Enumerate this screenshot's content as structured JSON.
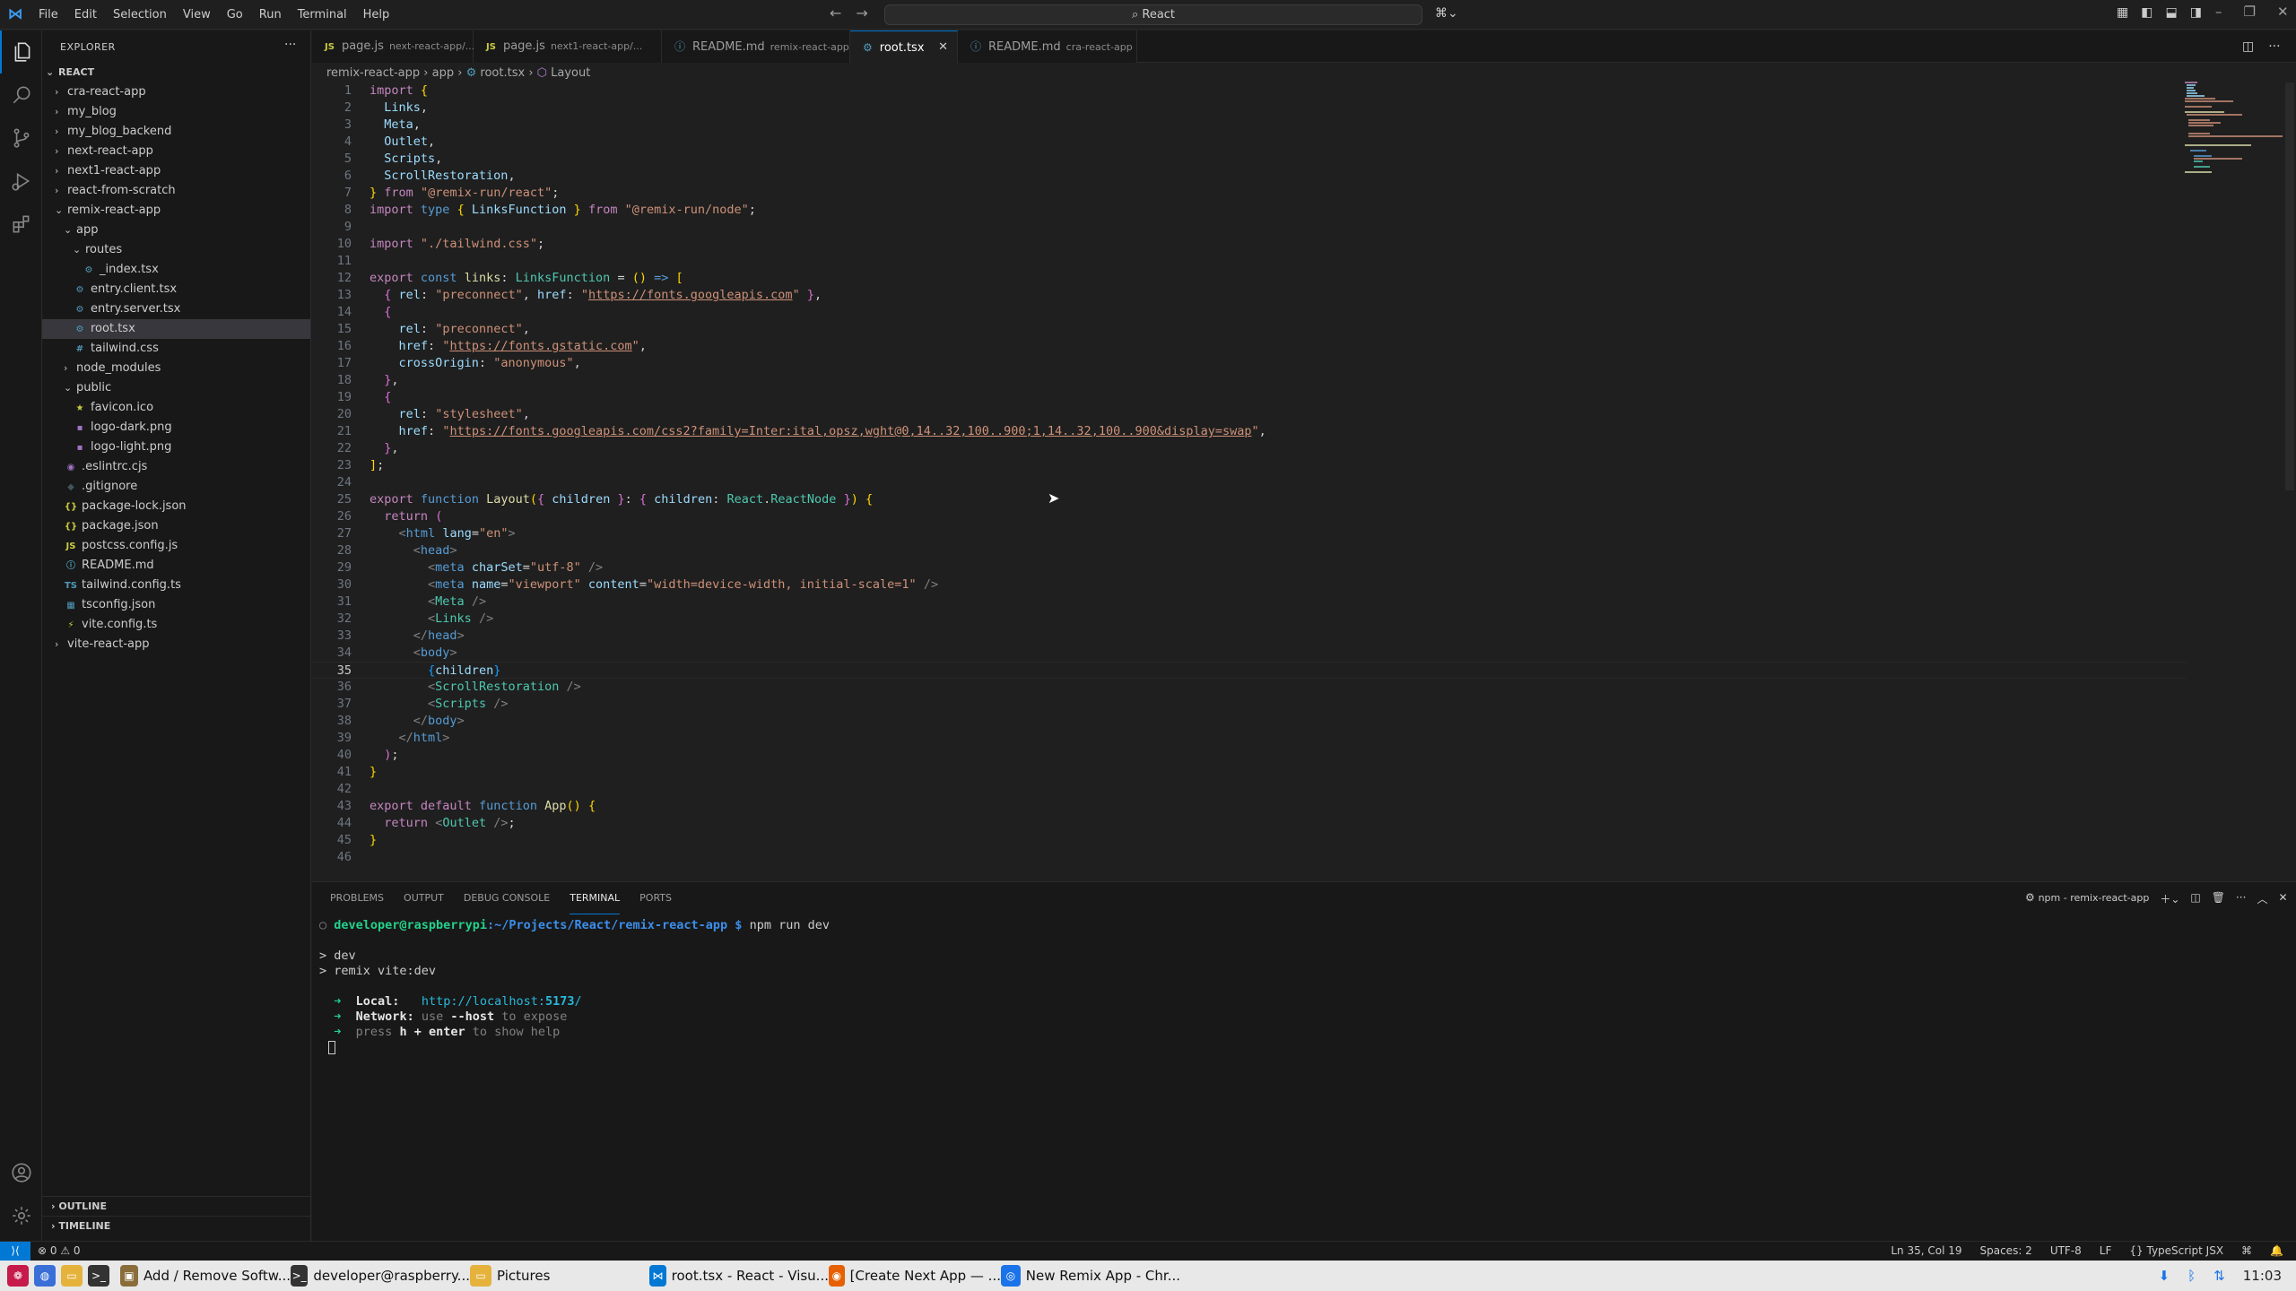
{
  "menu": [
    "File",
    "Edit",
    "Selection",
    "View",
    "Go",
    "Run",
    "Terminal",
    "Help"
  ],
  "command_center": "React",
  "sidebar": {
    "title": "EXPLORER",
    "root": "REACT",
    "tree": [
      {
        "label": "cra-react-app",
        "depth": 1,
        "type": "folder",
        "open": false
      },
      {
        "label": "my_blog",
        "depth": 1,
        "type": "folder",
        "open": false
      },
      {
        "label": "my_blog_backend",
        "depth": 1,
        "type": "folder",
        "open": false
      },
      {
        "label": "next-react-app",
        "depth": 1,
        "type": "folder",
        "open": false
      },
      {
        "label": "next1-react-app",
        "depth": 1,
        "type": "folder",
        "open": false
      },
      {
        "label": "react-from-scratch",
        "depth": 1,
        "type": "folder",
        "open": false
      },
      {
        "label": "remix-react-app",
        "depth": 1,
        "type": "folder",
        "open": true
      },
      {
        "label": "app",
        "depth": 2,
        "type": "folder",
        "open": true
      },
      {
        "label": "routes",
        "depth": 3,
        "type": "folder",
        "open": true
      },
      {
        "label": "_index.tsx",
        "depth": 4,
        "type": "tsx"
      },
      {
        "label": "entry.client.tsx",
        "depth": 3,
        "type": "tsx"
      },
      {
        "label": "entry.server.tsx",
        "depth": 3,
        "type": "tsx"
      },
      {
        "label": "root.tsx",
        "depth": 3,
        "type": "tsx",
        "selected": true
      },
      {
        "label": "tailwind.css",
        "depth": 3,
        "type": "css"
      },
      {
        "label": "node_modules",
        "depth": 2,
        "type": "folder",
        "open": false
      },
      {
        "label": "public",
        "depth": 2,
        "type": "folder",
        "open": true
      },
      {
        "label": "favicon.ico",
        "depth": 3,
        "type": "ico"
      },
      {
        "label": "logo-dark.png",
        "depth": 3,
        "type": "png"
      },
      {
        "label": "logo-light.png",
        "depth": 3,
        "type": "png"
      },
      {
        "label": ".eslintrc.cjs",
        "depth": 2,
        "type": "eslint"
      },
      {
        "label": ".gitignore",
        "depth": 2,
        "type": "git"
      },
      {
        "label": "package-lock.json",
        "depth": 2,
        "type": "json"
      },
      {
        "label": "package.json",
        "depth": 2,
        "type": "json"
      },
      {
        "label": "postcss.config.js",
        "depth": 2,
        "type": "js"
      },
      {
        "label": "README.md",
        "depth": 2,
        "type": "md"
      },
      {
        "label": "tailwind.config.ts",
        "depth": 2,
        "type": "ts"
      },
      {
        "label": "tsconfig.json",
        "depth": 2,
        "type": "tsjson"
      },
      {
        "label": "vite.config.ts",
        "depth": 2,
        "type": "vite"
      },
      {
        "label": "vite-react-app",
        "depth": 1,
        "type": "folder",
        "open": false
      }
    ],
    "outline": "OUTLINE",
    "timeline": "TIMELINE"
  },
  "tabs": [
    {
      "label": "page.js",
      "desc": "next-react-app/...",
      "icon": "JS"
    },
    {
      "label": "page.js",
      "desc": "next1-react-app/...",
      "icon": "JS"
    },
    {
      "label": "README.md",
      "desc": "remix-react-app",
      "icon": "ⓘ"
    },
    {
      "label": "root.tsx",
      "desc": "",
      "icon": "⚙",
      "active": true
    },
    {
      "label": "README.md",
      "desc": "cra-react-app",
      "icon": "ⓘ"
    }
  ],
  "breadcrumb": [
    "remix-react-app",
    "app",
    "root.tsx",
    "Layout"
  ],
  "panel": {
    "tabs": [
      "PROBLEMS",
      "OUTPUT",
      "DEBUG CONSOLE",
      "TERMINAL",
      "PORTS"
    ],
    "active_tab": "TERMINAL",
    "terminal_name": "npm - remix-react-app",
    "prompt_user": "developer@raspberrypi",
    "prompt_path": ":~/Projects/React/remix-react-app $",
    "command": " npm run dev",
    "lines": [
      "> dev",
      "> remix vite:dev"
    ],
    "local_label": "Local:",
    "local_url_prefix": "http://localhost:",
    "local_port": "5173",
    "local_url_suffix": "/",
    "network_label": "Network:",
    "network_text_a": "use ",
    "network_flag": "--host",
    "network_text_b": " to expose",
    "help_prefix": "press ",
    "help_key": "h + enter",
    "help_suffix": " to show help"
  },
  "status": {
    "problems": "⊗ 0 ⚠ 0",
    "position": "Ln 35, Col 19",
    "spaces": "Spaces: 2",
    "encoding": "UTF-8",
    "eol": "LF",
    "language": "TypeScript JSX"
  },
  "taskbar": {
    "items": [
      "Add / Remove Softw...",
      "developer@raspberry...",
      "Pictures",
      "root.tsx - React - Visu...",
      "[Create Next App — ...",
      "New Remix App - Chr..."
    ],
    "clock": "11:03"
  }
}
